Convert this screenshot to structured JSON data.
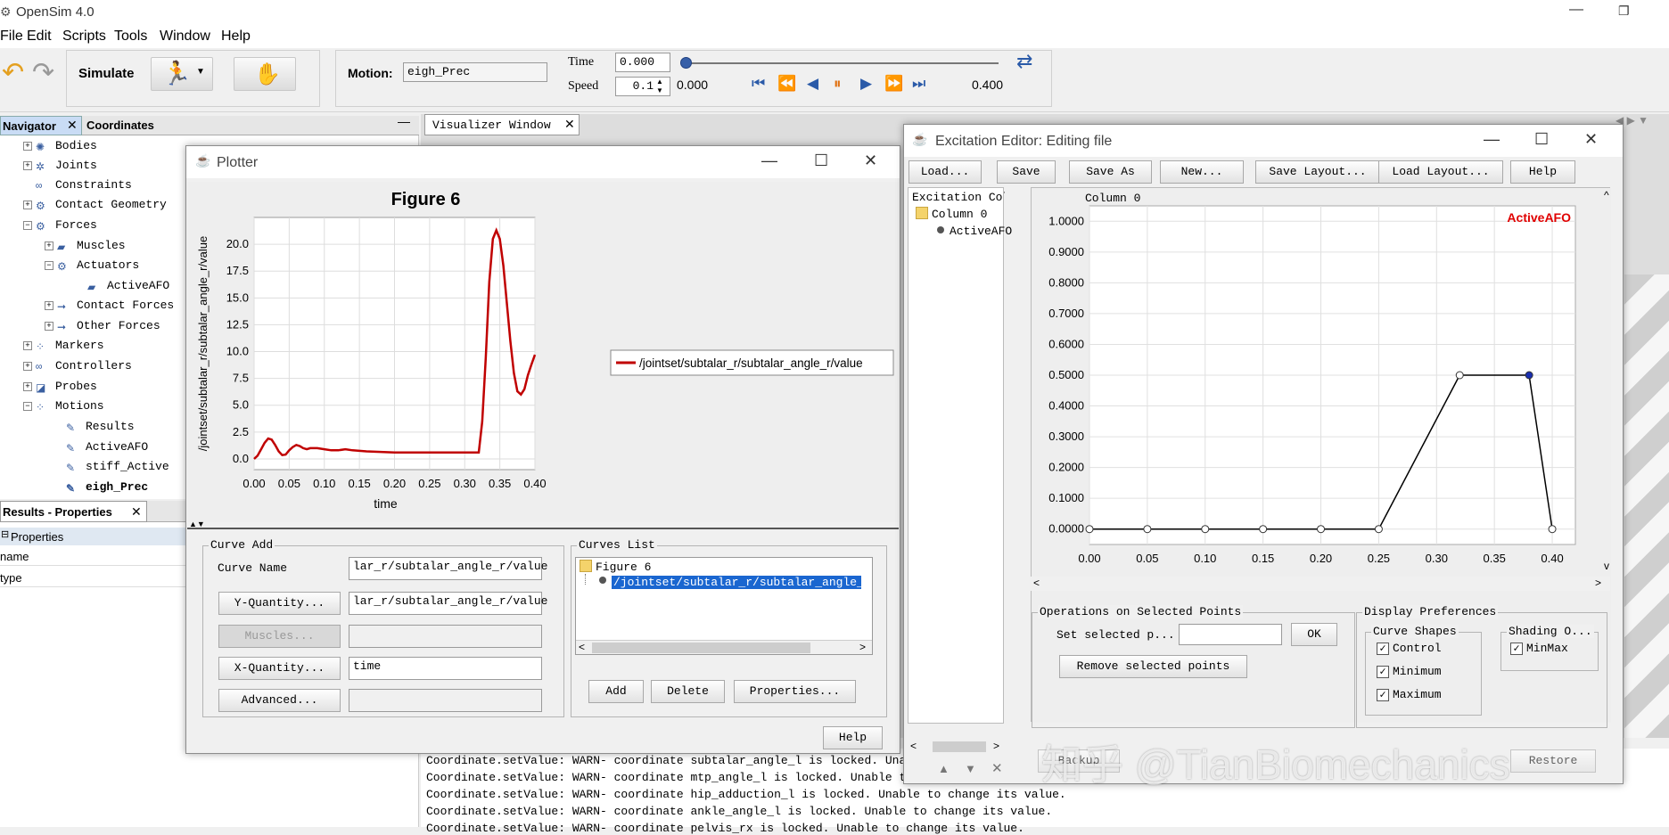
{
  "app": {
    "title": "OpenSim 4.0"
  },
  "menu": [
    "File",
    "Edit",
    "Scripts",
    "Tools",
    "Window",
    "Help"
  ],
  "toolbar": {
    "simulate": "Simulate",
    "motion_label": "Motion:",
    "motion_value": "eigh_Prec",
    "time_label": "Time",
    "time_value": "0.000",
    "speed_label": "Speed",
    "speed_value": "0.1",
    "start_time": "0.000",
    "end_time": "0.400"
  },
  "navigator": {
    "tab_nav": "Navigator",
    "tab_coord": "Coordinates",
    "items": [
      "Bodies",
      "Joints",
      "Constraints",
      "Contact Geometry",
      "Forces",
      "Muscles",
      "Actuators",
      "ActiveAFO",
      "Contact Forces",
      "Other Forces",
      "Markers",
      "Controllers",
      "Probes",
      "Motions",
      "Results",
      "ActiveAFO",
      "stiff_Active",
      "eigh_Prec"
    ]
  },
  "props": {
    "title": "Results - Properties",
    "section": "Properties",
    "rows": [
      "name",
      "type"
    ]
  },
  "visualizer": {
    "tab": "Visualizer Window"
  },
  "plotter": {
    "title": "Plotter",
    "figure": "Figure 6",
    "legend": "/jointset/subtalar_r/subtalar_angle_r/value",
    "curve_add": "Curve Add",
    "curve_name_label": "Curve Name",
    "curve_name_value": "lar_r/subtalar_angle_r/value",
    "y_quantity": "Y-Quantity...",
    "y_value": "lar_r/subtalar_angle_r/value",
    "muscles": "Muscles...",
    "x_quantity": "X-Quantity...",
    "x_value": "time",
    "advanced": "Advanced...",
    "curves_list": "Curves List",
    "tree_root": "Figure 6",
    "tree_item": "/jointset/subtalar_r/subtalar_angle_r",
    "add": "Add",
    "delete": "Delete",
    "properties": "Properties...",
    "help": "Help"
  },
  "excitation": {
    "title": "Excitation Editor: Editing file",
    "buttons": [
      "Load...",
      "Save",
      "Save As",
      "New...",
      "Save Layout...",
      "Load Layout...",
      "Help"
    ],
    "tree_header": "Excitation Colum",
    "tree_col": "Column 0",
    "tree_leaf": "ActiveAFO",
    "ops_group": "Operations on Selected Points",
    "set_selected": "Set selected p...",
    "ok": "OK",
    "remove": "Remove selected points",
    "display_group": "Display Preferences",
    "curve_shapes": "Curve Shapes",
    "control": "Control",
    "minimum": "Minimum",
    "maximum": "Maximum",
    "shading": "Shading O...",
    "minmax": "MinMax",
    "backup": "Backup",
    "restore": "Restore"
  },
  "log": [
    "Coordinate.setValue: WARN- coordinate subtalar_angle_l is locked. Unable to change its value.",
    "Coordinate.setValue: WARN- coordinate mtp_angle_l is locked. Unable to change its value.",
    "Coordinate.setValue: WARN- coordinate hip_adduction_l is locked. Unable to change its value.",
    "Coordinate.setValue: WARN- coordinate ankle_angle_l is locked. Unable to change its value.",
    "Coordinate.setValue: WARN- coordinate pelvis_rx is locked. Unable to change its value."
  ],
  "watermark": "知乎 @TianBiomechanics",
  "chart_data": [
    {
      "type": "line",
      "title": "Figure 6",
      "xlabel": "time",
      "ylabel": "/jointset/subtalar_r/subtalar_angle_r/value",
      "xlim": [
        0,
        0.4
      ],
      "ylim": [
        -1,
        22.5
      ],
      "xticks": [
        "0.00",
        "0.05",
        "0.10",
        "0.15",
        "0.20",
        "0.25",
        "0.30",
        "0.35",
        "0.40"
      ],
      "yticks": [
        "0.0",
        "2.5",
        "5.0",
        "7.5",
        "10.0",
        "12.5",
        "15.0",
        "17.5",
        "20.0"
      ],
      "series": [
        {
          "name": "/jointset/subtalar_r/subtalar_angle_r/value",
          "color": "#c00000",
          "x": [
            0,
            0.005,
            0.01,
            0.015,
            0.02,
            0.025,
            0.03,
            0.035,
            0.04,
            0.045,
            0.05,
            0.055,
            0.06,
            0.065,
            0.07,
            0.075,
            0.08,
            0.09,
            0.1,
            0.11,
            0.12,
            0.13,
            0.14,
            0.15,
            0.16,
            0.18,
            0.2,
            0.22,
            0.24,
            0.26,
            0.28,
            0.3,
            0.32,
            0.325,
            0.33,
            0.335,
            0.34,
            0.345,
            0.35,
            0.355,
            0.36,
            0.365,
            0.37,
            0.375,
            0.38,
            0.385,
            0.39,
            0.395,
            0.4
          ],
          "y": [
            0,
            0.3,
            0.9,
            1.5,
            1.9,
            1.8,
            1.3,
            0.7,
            0.35,
            0.4,
            0.8,
            1.1,
            1.3,
            1.2,
            1.0,
            0.9,
            1.0,
            1.0,
            0.9,
            0.8,
            0.8,
            0.9,
            0.8,
            0.75,
            0.7,
            0.65,
            0.6,
            0.6,
            0.6,
            0.6,
            0.6,
            0.6,
            0.6,
            3.5,
            9.5,
            16.5,
            20.5,
            21.3,
            20.5,
            18.0,
            14.5,
            11.0,
            8.0,
            6.3,
            6.0,
            6.5,
            7.8,
            8.8,
            9.7
          ]
        }
      ]
    },
    {
      "type": "line",
      "title": "Column 0",
      "label": "ActiveAFO",
      "xlim": [
        0,
        0.42
      ],
      "ylim": [
        -0.05,
        1.05
      ],
      "xticks": [
        "0.00",
        "0.05",
        "0.10",
        "0.15",
        "0.20",
        "0.25",
        "0.30",
        "0.35",
        "0.40"
      ],
      "yticks": [
        "0.0000",
        "0.1000",
        "0.2000",
        "0.3000",
        "0.4000",
        "0.5000",
        "0.6000",
        "0.7000",
        "0.8000",
        "0.9000",
        "1.0000"
      ],
      "series": [
        {
          "name": "ActiveAFO",
          "color": "#000000",
          "x": [
            0,
            0.05,
            0.1,
            0.15,
            0.2,
            0.25,
            0.32,
            0.38,
            0.4
          ],
          "y": [
            0,
            0,
            0,
            0,
            0,
            0,
            0.5,
            0.5,
            0
          ]
        }
      ]
    }
  ]
}
